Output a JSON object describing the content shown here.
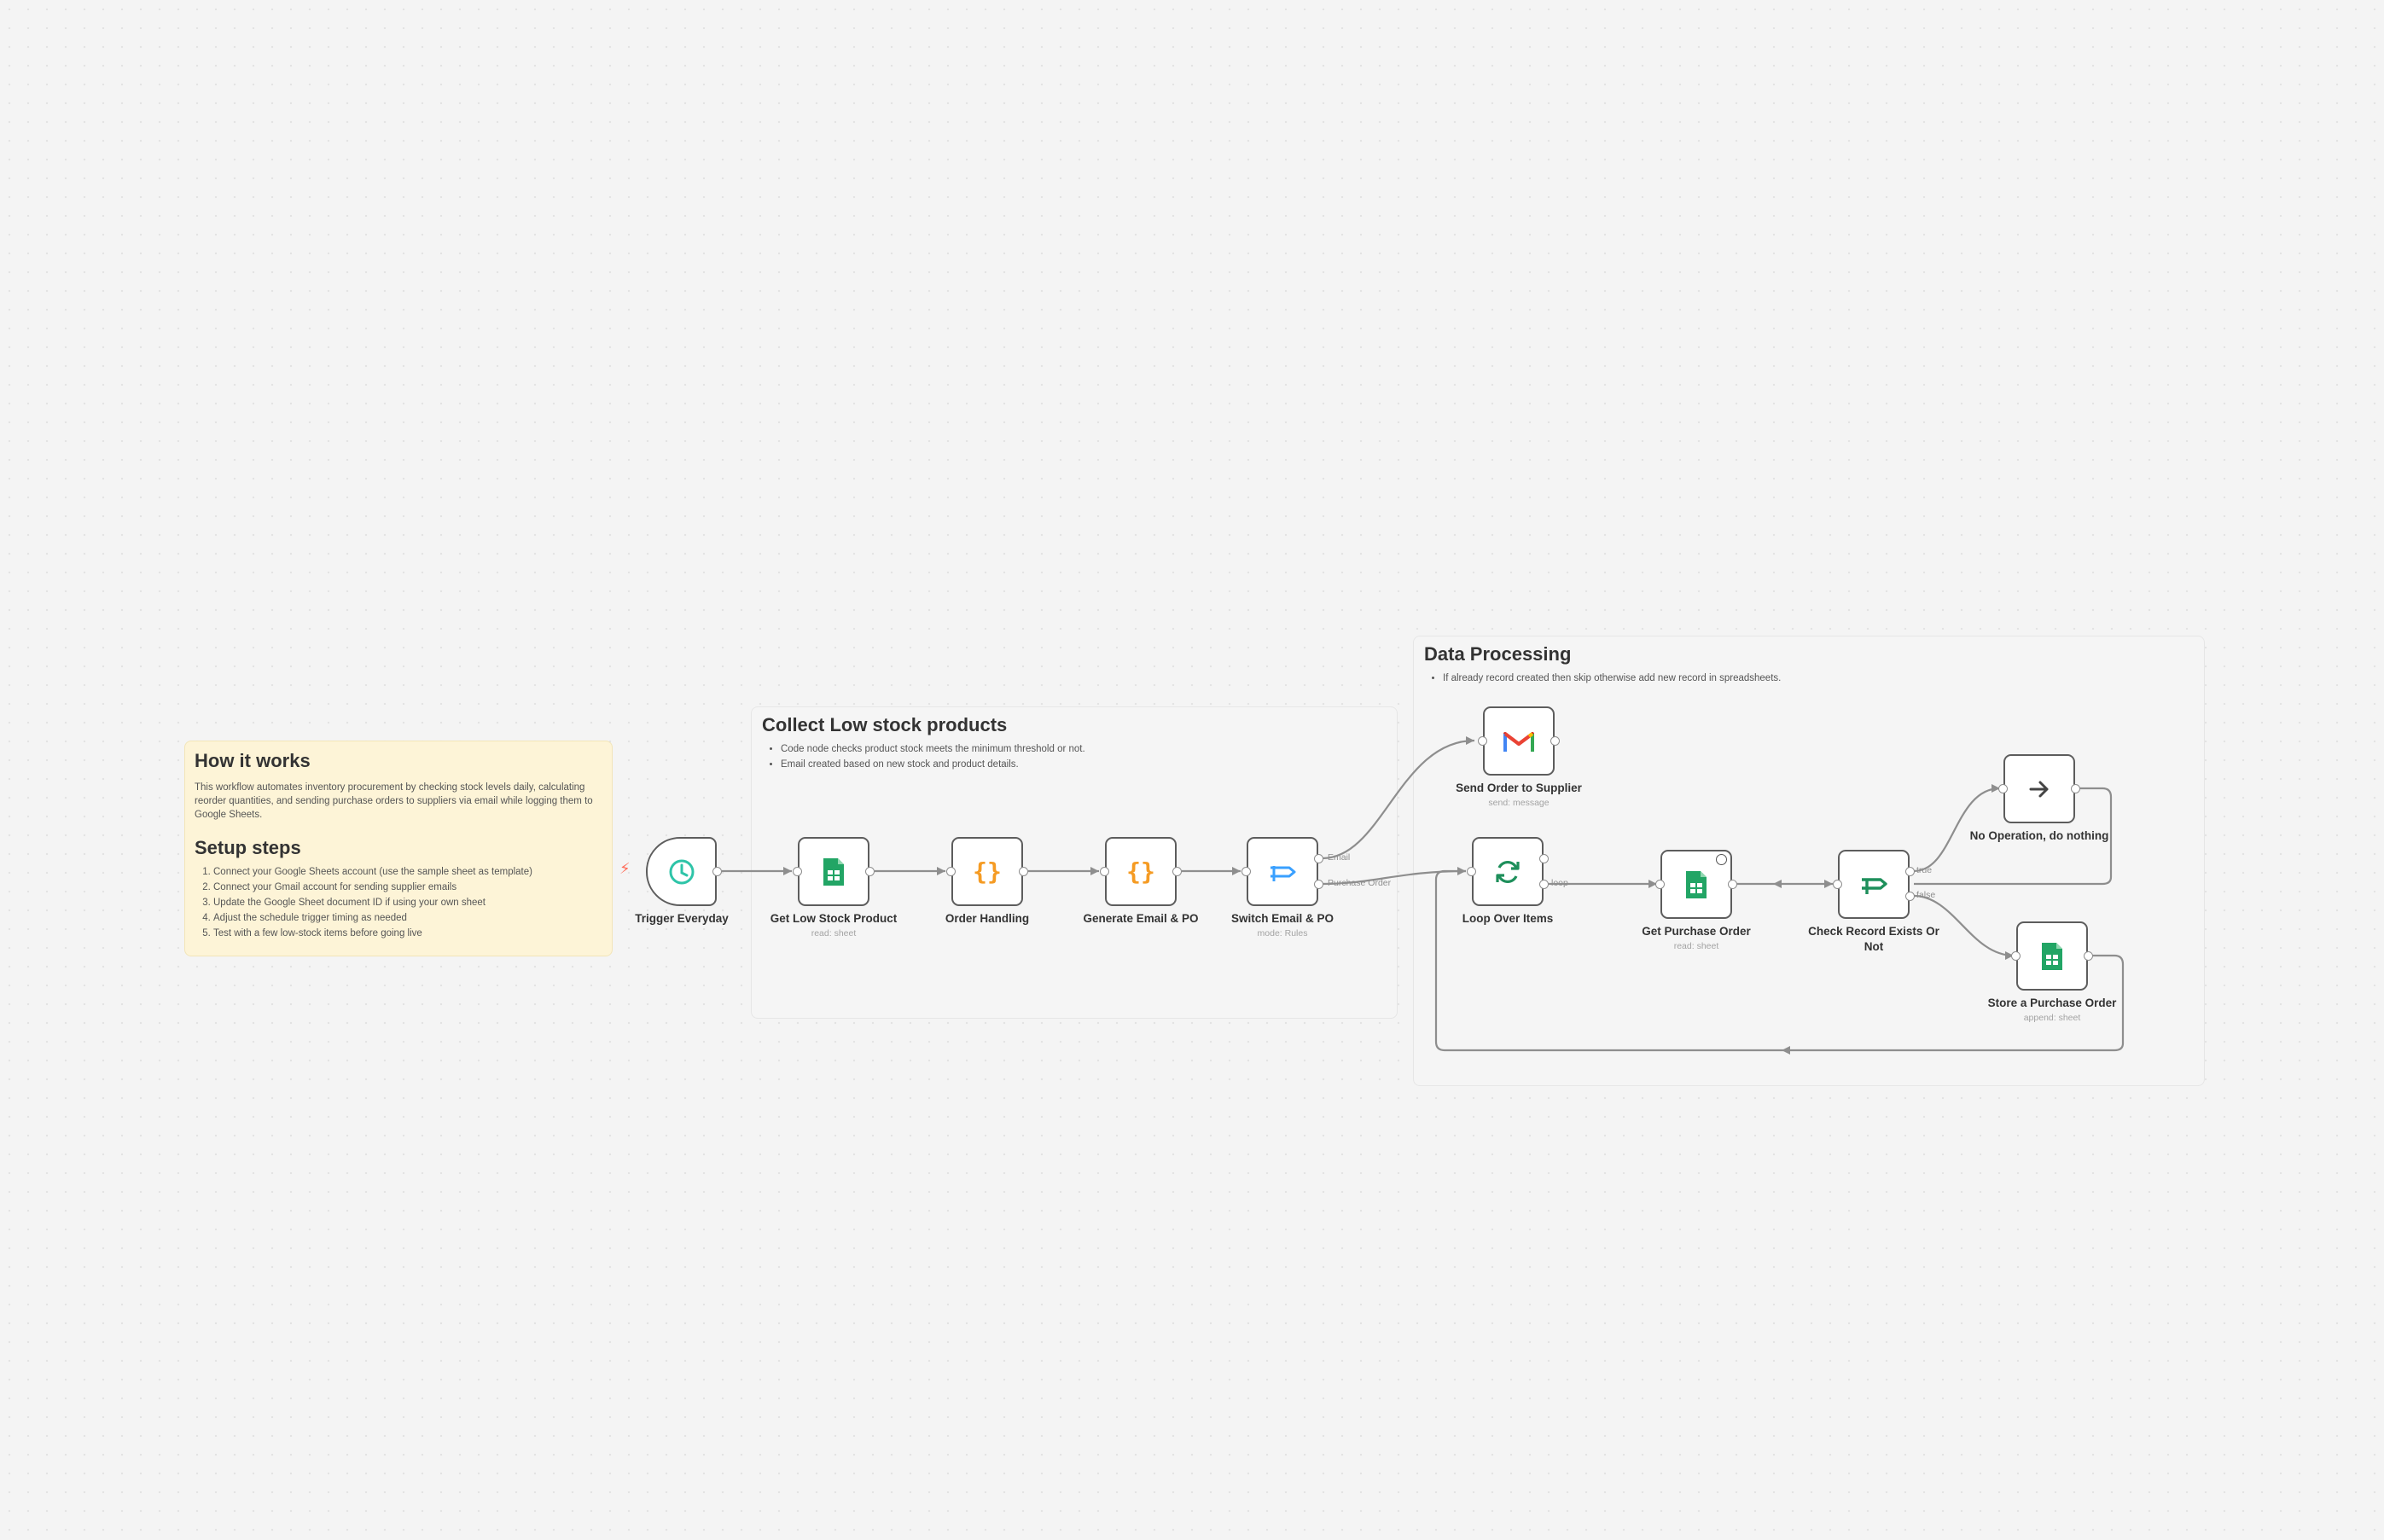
{
  "stickies": {
    "how": {
      "title": "How it works",
      "body": "This workflow automates inventory procurement by checking stock levels daily, calculating reorder quantities, and sending purchase orders to suppliers via email while logging them to Google Sheets.",
      "setup_title": "Setup steps",
      "steps": [
        "Connect your Google Sheets account (use the sample sheet as template)",
        "Connect your Gmail account for sending supplier emails",
        "Update the Google Sheet document ID if using your own sheet",
        "Adjust the schedule trigger timing as needed",
        "Test with a few low-stock items before going live"
      ]
    },
    "collect": {
      "title": "Collect Low stock products",
      "bullets": [
        "Code node checks product stock meets the minimum threshold or not.",
        "Email created based on new stock and product details."
      ]
    },
    "processing": {
      "title": "Data Processing",
      "bullets": [
        "If already record created then skip otherwise add new record in spreadsheets."
      ]
    }
  },
  "nodes": {
    "trigger": {
      "label": "Trigger Everyday",
      "icon": "clock-icon"
    },
    "get_low_stock": {
      "label": "Get Low Stock Product",
      "sub": "read: sheet",
      "icon": "google-sheets-icon"
    },
    "order_handling": {
      "label": "Order Handling",
      "icon": "code-braces-icon"
    },
    "generate_email": {
      "label": "Generate Email & PO",
      "icon": "code-braces-icon"
    },
    "switch": {
      "label": "Switch Email & PO",
      "sub": "mode: Rules",
      "icon": "switch-arrows-icon"
    },
    "send_order": {
      "label": "Send Order to Supplier",
      "sub": "send: message",
      "icon": "gmail-icon"
    },
    "loop": {
      "label": "Loop Over Items",
      "icon": "loop-refresh-icon"
    },
    "get_po": {
      "label": "Get Purchase Order",
      "sub": "read: sheet",
      "icon": "google-sheets-icon"
    },
    "check_record": {
      "label": "Check Record Exists Or Not",
      "icon": "if-branch-icon"
    },
    "no_op": {
      "label": "No Operation, do nothing",
      "icon": "arrow-right-icon"
    },
    "store_po": {
      "label": "Store a Purchase Order",
      "sub": "append: sheet",
      "icon": "google-sheets-icon"
    }
  },
  "outputs": {
    "switch_email": "Email",
    "switch_po": "Purchase Order",
    "loop_loop": "loop",
    "check_true": "true",
    "check_false": "false"
  },
  "colors": {
    "sheets_green": "#22a565",
    "code_orange": "#f59b23",
    "switch_blue": "#3aa0ff",
    "trigger_teal": "#2ec4a8",
    "if_green": "#1e8f5b",
    "edge": "#8e8e8e"
  }
}
